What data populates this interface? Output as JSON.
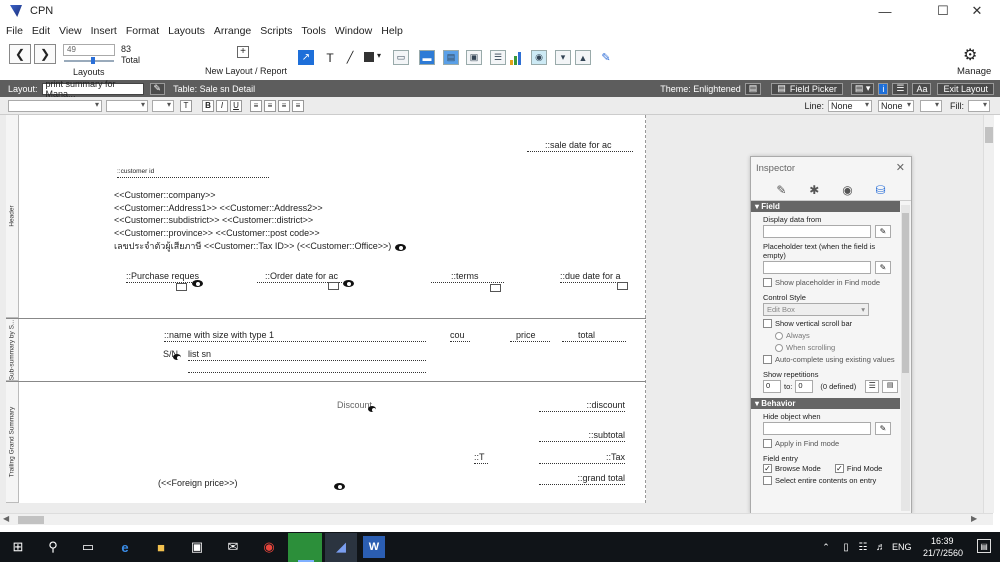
{
  "window": {
    "title": "CPN"
  },
  "menu": [
    "File",
    "Edit",
    "View",
    "Insert",
    "Format",
    "Layouts",
    "Arrange",
    "Scripts",
    "Tools",
    "Window",
    "Help"
  ],
  "toolbar": {
    "record_value": "49",
    "total_value": "83",
    "total_label": "Total",
    "layouts_label": "Layouts",
    "new_layout_label": "New Layout / Report",
    "manage_label": "Manage"
  },
  "layoutbar": {
    "layout_label": "Layout:",
    "layout_value": "print summary for Mana...",
    "table_label": "Table: Sale sn Detail",
    "theme_label": "Theme: Enlightened",
    "field_picker_label": "Field Picker",
    "aa_label": "Aa",
    "exit_label": "Exit Layout"
  },
  "formatbar": {
    "line_label": "Line:",
    "line_value": "None",
    "line_value2": "None",
    "fill_label": "Fill:"
  },
  "parts": {
    "header": "Header",
    "subsummary": "Sub-summary by S...",
    "trailing": "Trailing Grand Summary"
  },
  "layout": {
    "sale_date": "::sale date for ac",
    "customer_id": "::customer id",
    "company": "<<Customer::company>>",
    "address": "<<Customer::Address1>> <<Customer::Address2>>",
    "district": "<<Customer::subdistrict>> <<Customer::district>>",
    "province": "<<Customer::province>> <<Customer::post code>>",
    "tax": "เลขประจำตัวผู้เสียภาษี <<Customer::Tax ID>> (<<Customer::Office>>)",
    "purchase": "::Purchase reques",
    "order_date": "::Order date for ac",
    "terms": "::terms",
    "due_date": "::due date for a",
    "name_size": "::name with size with type 1",
    "count": "cou",
    "price": "price",
    "total": "total",
    "sn_label": "S/N",
    "list_sn": "list sn",
    "discount_label": "Discount",
    "discount": "::discount",
    "subtotal": "::subtotal",
    "t_field": "::T",
    "tax_field": "::Tax",
    "grand_total": "::grand total",
    "foreign_price": "(<<Foreign price>>)"
  },
  "inspector": {
    "title": "Inspector",
    "field_section": "Field",
    "display_data_from": "Display data from",
    "placeholder_text": "Placeholder text (when the field is empty)",
    "show_placeholder": "Show placeholder in Find mode",
    "control_style": "Control Style",
    "edit_box": "Edit Box",
    "show_vscroll": "Show vertical scroll bar",
    "always": "Always",
    "when_scrolling": "When scrolling",
    "autocomplete": "Auto-complete using existing values",
    "show_repetitions": "Show repetitions",
    "rep_from": "0",
    "rep_to_label": "to:",
    "rep_to": "0",
    "rep_defined": "(0 defined)",
    "behavior_section": "Behavior",
    "hide_object": "Hide object when",
    "apply_find": "Apply in Find mode",
    "field_entry": "Field entry",
    "browse_mode": "Browse Mode",
    "find_mode": "Find Mode",
    "select_entire": "Select entire contents on entry"
  },
  "taskbar": {
    "lang": "ENG",
    "time": "16:39",
    "date": "21/7/2560"
  },
  "colors": {
    "layoutbar_bg": "#5d5d5d",
    "accent_blue": "#1e6fd9",
    "taskbar_bg": "#101418"
  }
}
